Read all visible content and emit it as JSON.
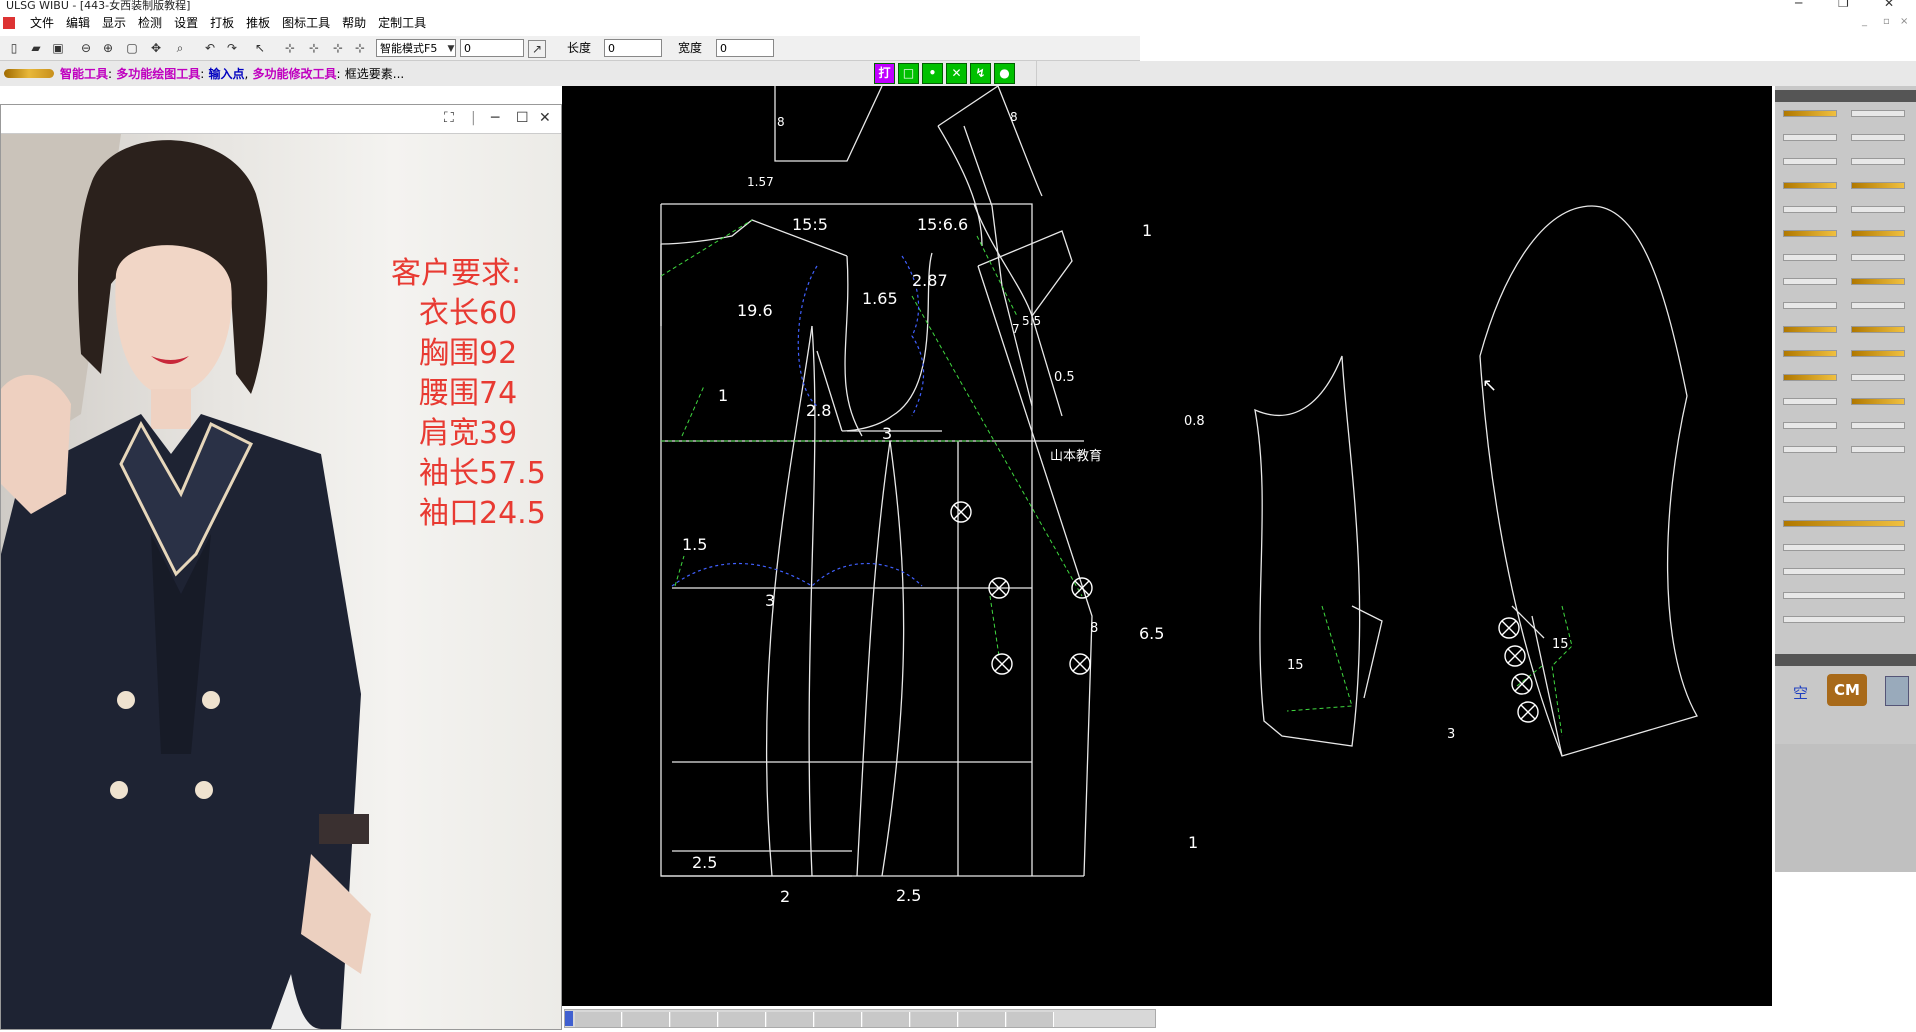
{
  "window": {
    "title": "ULSG WIBU - [443-女西装制版教程]",
    "controls": [
      "─",
      "❐",
      "✕"
    ],
    "mdi_controls": [
      "_",
      "▫",
      "×"
    ]
  },
  "menu": [
    "文件",
    "编辑",
    "显示",
    "检测",
    "设置",
    "打板",
    "推板",
    "图标工具",
    "帮助",
    "定制工具"
  ],
  "toolbar": {
    "mode_value": "智能模式F5",
    "mode_field_value": "0",
    "length_label": "长度",
    "length_value": "0",
    "width_label": "宽度",
    "width_value": "0"
  },
  "status": {
    "p1": "智能工具",
    "p2": "多功能绘图工具",
    "p3": "输入点",
    "p4": "多功能修改工具",
    "p5": "框选要素...",
    "snap_buttons": [
      "打",
      "□",
      "•",
      "✕",
      "↯",
      "●"
    ]
  },
  "photo_window": {
    "requirements_title": "客户要求:",
    "requirements": [
      "衣长60",
      "胸围92",
      "腰围74",
      "肩宽39",
      "袖长57.5",
      "袖口24.5"
    ]
  },
  "canvas": {
    "watermark": "山本教育",
    "dims": [
      "8",
      "1.57",
      "15:5",
      "15:6.6",
      "8",
      "1",
      "19.6",
      "1.65",
      "2.87",
      "5.5",
      "7",
      "0.5",
      "0.8",
      "1",
      "2.8",
      "3",
      "1.5",
      "3",
      "8",
      "6.5",
      "2.5",
      "2",
      "2.5",
      "1",
      "15",
      "15",
      "3"
    ]
  },
  "right_panel": {
    "unit_button": "CM",
    "space_label": "空"
  },
  "colors": {
    "canvas_bg": "#000000",
    "pattern_line": "#e8e8e8",
    "aux_line": "#3fd83f",
    "dart_line": "#4060ff",
    "requirement_text": "#e83a32",
    "status_magenta": "#c000c0",
    "status_blue": "#0000c0"
  },
  "icons": [
    "app-icon",
    "new-icon",
    "open-icon",
    "save-icon",
    "zoom-out-icon",
    "zoom-in-icon",
    "fit-icon",
    "pan-icon",
    "undo-icon",
    "redo-icon",
    "select-icon",
    "pencil-tool-icon",
    "calculator-icon"
  ]
}
